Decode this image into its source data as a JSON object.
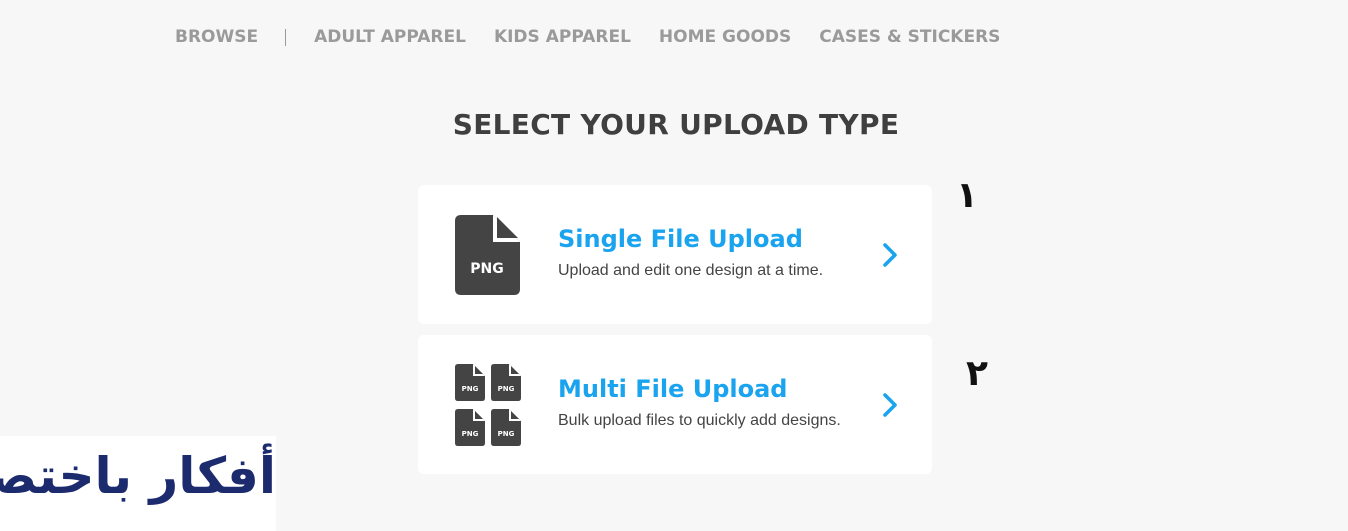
{
  "nav": {
    "items": [
      {
        "label": "BROWSE"
      },
      {
        "label": "ADULT APPAREL"
      },
      {
        "label": "KIDS APPAREL"
      },
      {
        "label": "HOME GOODS"
      },
      {
        "label": "CASES & STICKERS"
      }
    ]
  },
  "page": {
    "title": "SELECT YOUR UPLOAD TYPE"
  },
  "cards": {
    "single": {
      "title": "Single File Upload",
      "description": "Upload and edit one design at a time.",
      "icon_label": "PNG",
      "icon": "png-file-icon"
    },
    "multi": {
      "title": "Multi File Upload",
      "description": "Bulk upload files to quickly add designs.",
      "icon_labels": [
        "PNG",
        "PNG",
        "PNG",
        "PNG"
      ],
      "icon": "multi-png-files-icon"
    }
  },
  "annotations": {
    "one": "١",
    "two": "٢"
  },
  "watermark": {
    "text": "أفكار باختصار"
  },
  "colors": {
    "background": "#f7f7f7",
    "nav_text": "#9a9a9a",
    "title_text": "#3f3f3f",
    "accent": "#1aa3ee",
    "icon_fill": "#444444",
    "logo_primary": "#1c2a6e",
    "logo_accent": "#f29a1f"
  }
}
